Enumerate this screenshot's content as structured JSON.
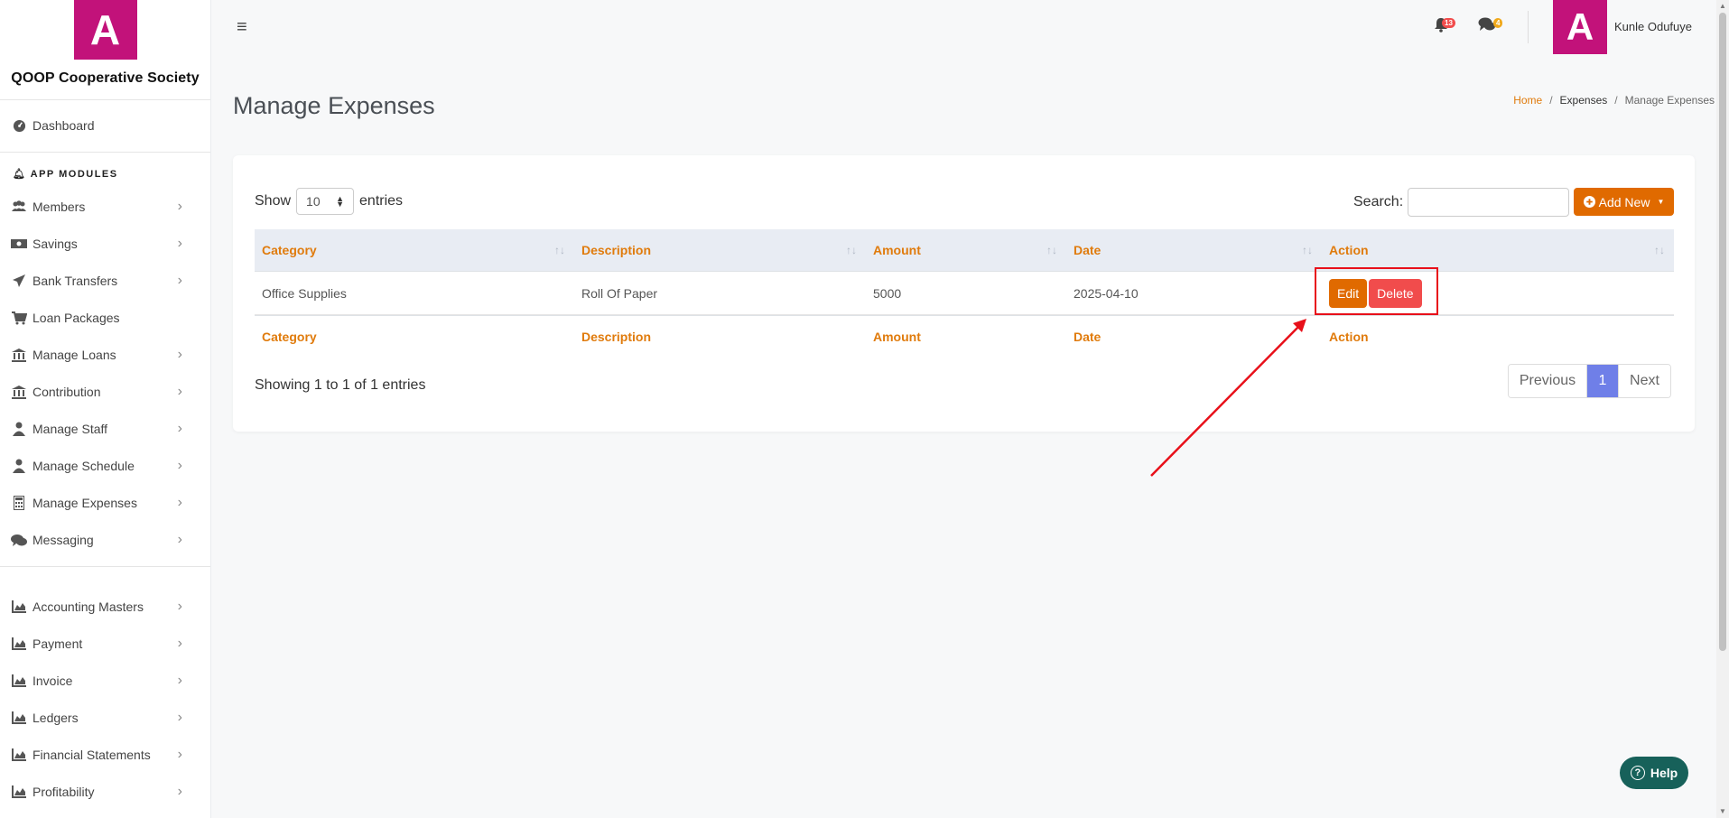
{
  "brand": {
    "logo_letter": "A",
    "name": "QOOP Cooperative Society",
    "color": "#c2127a"
  },
  "sidebar": {
    "dashboard": "Dashboard",
    "section_title": "APP MODULES",
    "items": [
      {
        "label": "Members",
        "icon": "users-icon"
      },
      {
        "label": "Savings",
        "icon": "money-icon"
      },
      {
        "label": "Bank Transfers",
        "icon": "paper-plane-icon"
      },
      {
        "label": "Loan Packages",
        "icon": "cart-icon"
      },
      {
        "label": "Manage Loans",
        "icon": "bank-icon"
      },
      {
        "label": "Contribution",
        "icon": "bank-icon"
      },
      {
        "label": "Manage Staff",
        "icon": "user-icon"
      },
      {
        "label": "Manage Schedule",
        "icon": "user-icon"
      },
      {
        "label": "Manage Expenses",
        "icon": "calculator-icon"
      },
      {
        "label": "Messaging",
        "icon": "comments-icon"
      }
    ],
    "items2": [
      {
        "label": "Accounting Masters",
        "icon": "chart-icon"
      },
      {
        "label": "Payment",
        "icon": "chart-icon"
      },
      {
        "label": "Invoice",
        "icon": "chart-icon"
      },
      {
        "label": "Ledgers",
        "icon": "chart-icon"
      },
      {
        "label": "Financial Statements",
        "icon": "chart-icon"
      },
      {
        "label": "Profitability",
        "icon": "chart-icon"
      }
    ]
  },
  "topbar": {
    "notifications_count": "13",
    "messages_count": "4",
    "avatar_letter": "A",
    "username": "Kunle Odufuye"
  },
  "page": {
    "title": "Manage Expenses",
    "breadcrumb": {
      "home": "Home",
      "section": "Expenses",
      "current": "Manage Expenses"
    }
  },
  "table_controls": {
    "show_label": "Show",
    "entries_value": "10",
    "entries_label": "entries",
    "search_label": "Search:",
    "search_value": "",
    "add_new_label": "Add New"
  },
  "table": {
    "headers": [
      "Category",
      "Description",
      "Amount",
      "Date",
      "Action"
    ],
    "rows": [
      {
        "category": "Office Supplies",
        "description": "Roll Of Paper",
        "amount": "5000",
        "date": "2025-04-10"
      }
    ],
    "edit_label": "Edit",
    "delete_label": "Delete"
  },
  "footer": {
    "showing": "Showing 1 to 1 of 1 entries",
    "previous": "Previous",
    "page": "1",
    "next": "Next"
  },
  "help_label": "Help",
  "colors": {
    "accent": "#e06a00",
    "danger": "#f14c4c",
    "pager_active": "#6f7fe8",
    "highlight": "#e8101a",
    "help": "#17615a"
  }
}
